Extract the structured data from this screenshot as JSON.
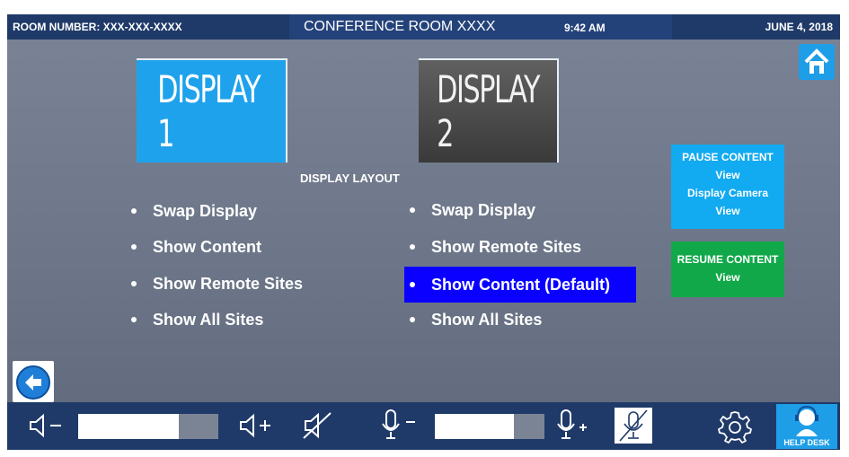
{
  "header": {
    "room_number": "ROOM NUMBER: XXX-XXX-XXXX",
    "title": "CONFERENCE ROOM XXXX",
    "time": "9:42 AM",
    "date": "JUNE 4, 2018"
  },
  "home_button": {
    "icon": "home-icon"
  },
  "displays": [
    {
      "label": "DISPLAY 1",
      "color": "#1fa2ec",
      "selected": true
    },
    {
      "label": "DISPLAY 2",
      "color": "#4a4a4a",
      "selected": false
    }
  ],
  "layout_label": "DISPLAY LAYOUT",
  "options_left": [
    "Swap Display",
    "Show Content",
    "Show Remote Sites",
    "Show All Sites"
  ],
  "options_right": [
    "Swap Display",
    "Show Remote Sites",
    "Show Content (Default)",
    "Show All Sites"
  ],
  "selected_right_option": "Show Content (Default)",
  "pause_button": [
    "PAUSE CONTENT",
    "View",
    "Display Camera",
    "View"
  ],
  "resume_button": [
    "RESUME CONTENT",
    "View"
  ],
  "back_button": {
    "icon": "back-arrow-icon"
  },
  "bottom_bar": {
    "speaker_volume_level": 0.72,
    "mic_volume_level": 0.72,
    "help_desk_label": "HELP DESK"
  },
  "colors": {
    "bar": "#1f3a68",
    "accent_blue": "#1fa2ec",
    "selected_option": "#0a00ff",
    "resume_green": "#11a84a"
  }
}
